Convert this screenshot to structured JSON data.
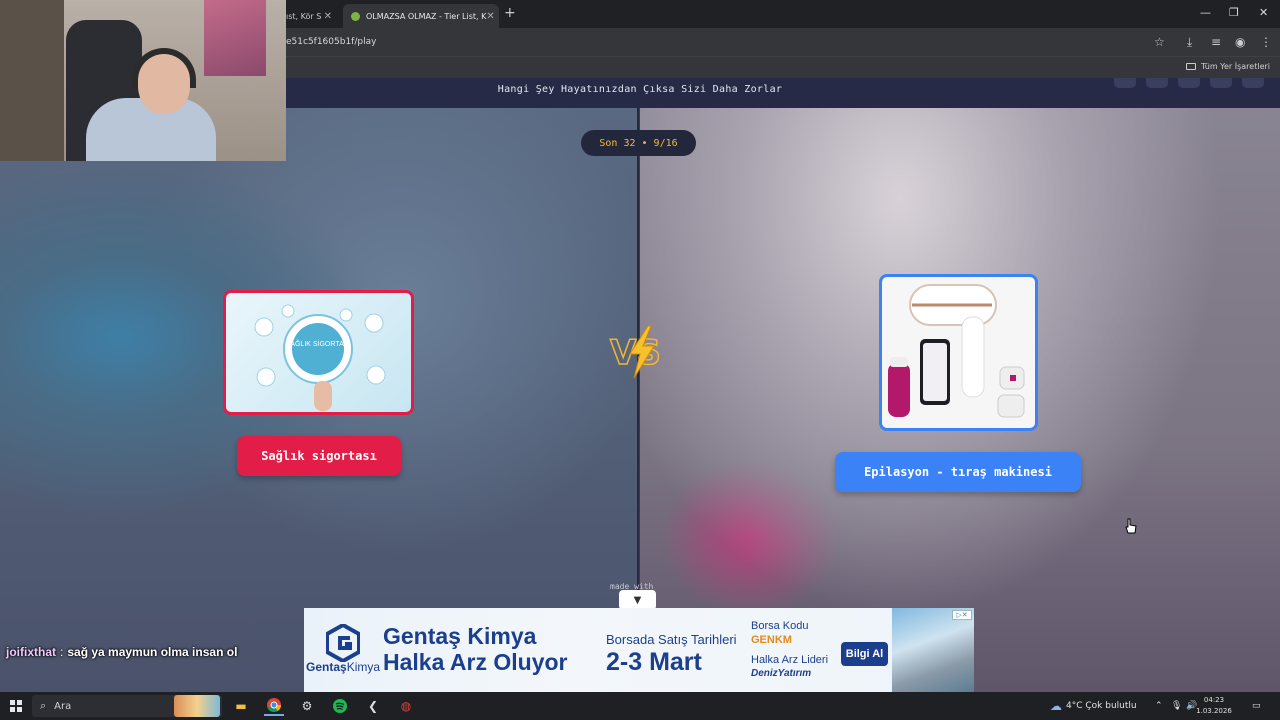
{
  "browser": {
    "tabs": [
      {
        "title": "ıst, Kör S"
      },
      {
        "title": "OLMAZSA OLMAZ - Tier List, K",
        "active": true
      }
    ],
    "new_tab": "+",
    "url": "e51c5f1605b1f/play",
    "bookmarks_label": "Tüm Yer İşaretleri"
  },
  "game": {
    "question": "Hangi Şey Hayatınızdan Çıksa Sizi Daha Zorlar",
    "round": "Son 32 • 9/16",
    "left_option": {
      "label": "Sağlık sigortası",
      "image_text": "SAĞLIK SİGORTASI",
      "color": "#e21d47"
    },
    "right_option": {
      "label": "Epilasyon - tıraş makinesi",
      "color": "#3b82f6"
    },
    "vs_label": "VS",
    "made_with": "made with",
    "collapse_icon": "chevron-down-icon"
  },
  "ad": {
    "brand": "Gentaş",
    "brand_suffix": "Kimya",
    "headline_1": "Gentaş Kimya",
    "headline_2": "Halka Arz Oluyor",
    "dates_label": "Borsada Satış Tarihleri",
    "dates": "2-3 Mart",
    "code_label": "Borsa Kodu",
    "code": "GENKM",
    "lead_label": "Halka Arz Lideri",
    "lead": "DenizYatırım",
    "cta": "Bilgi Al"
  },
  "chat": {
    "user": "joifixthat",
    "message": "sağ ya maymun olma insan ol"
  },
  "taskbar": {
    "search_placeholder": "Ara",
    "weather": "4°C  Çok bulutlu",
    "time": "04:23",
    "date": "1.03.2026"
  }
}
